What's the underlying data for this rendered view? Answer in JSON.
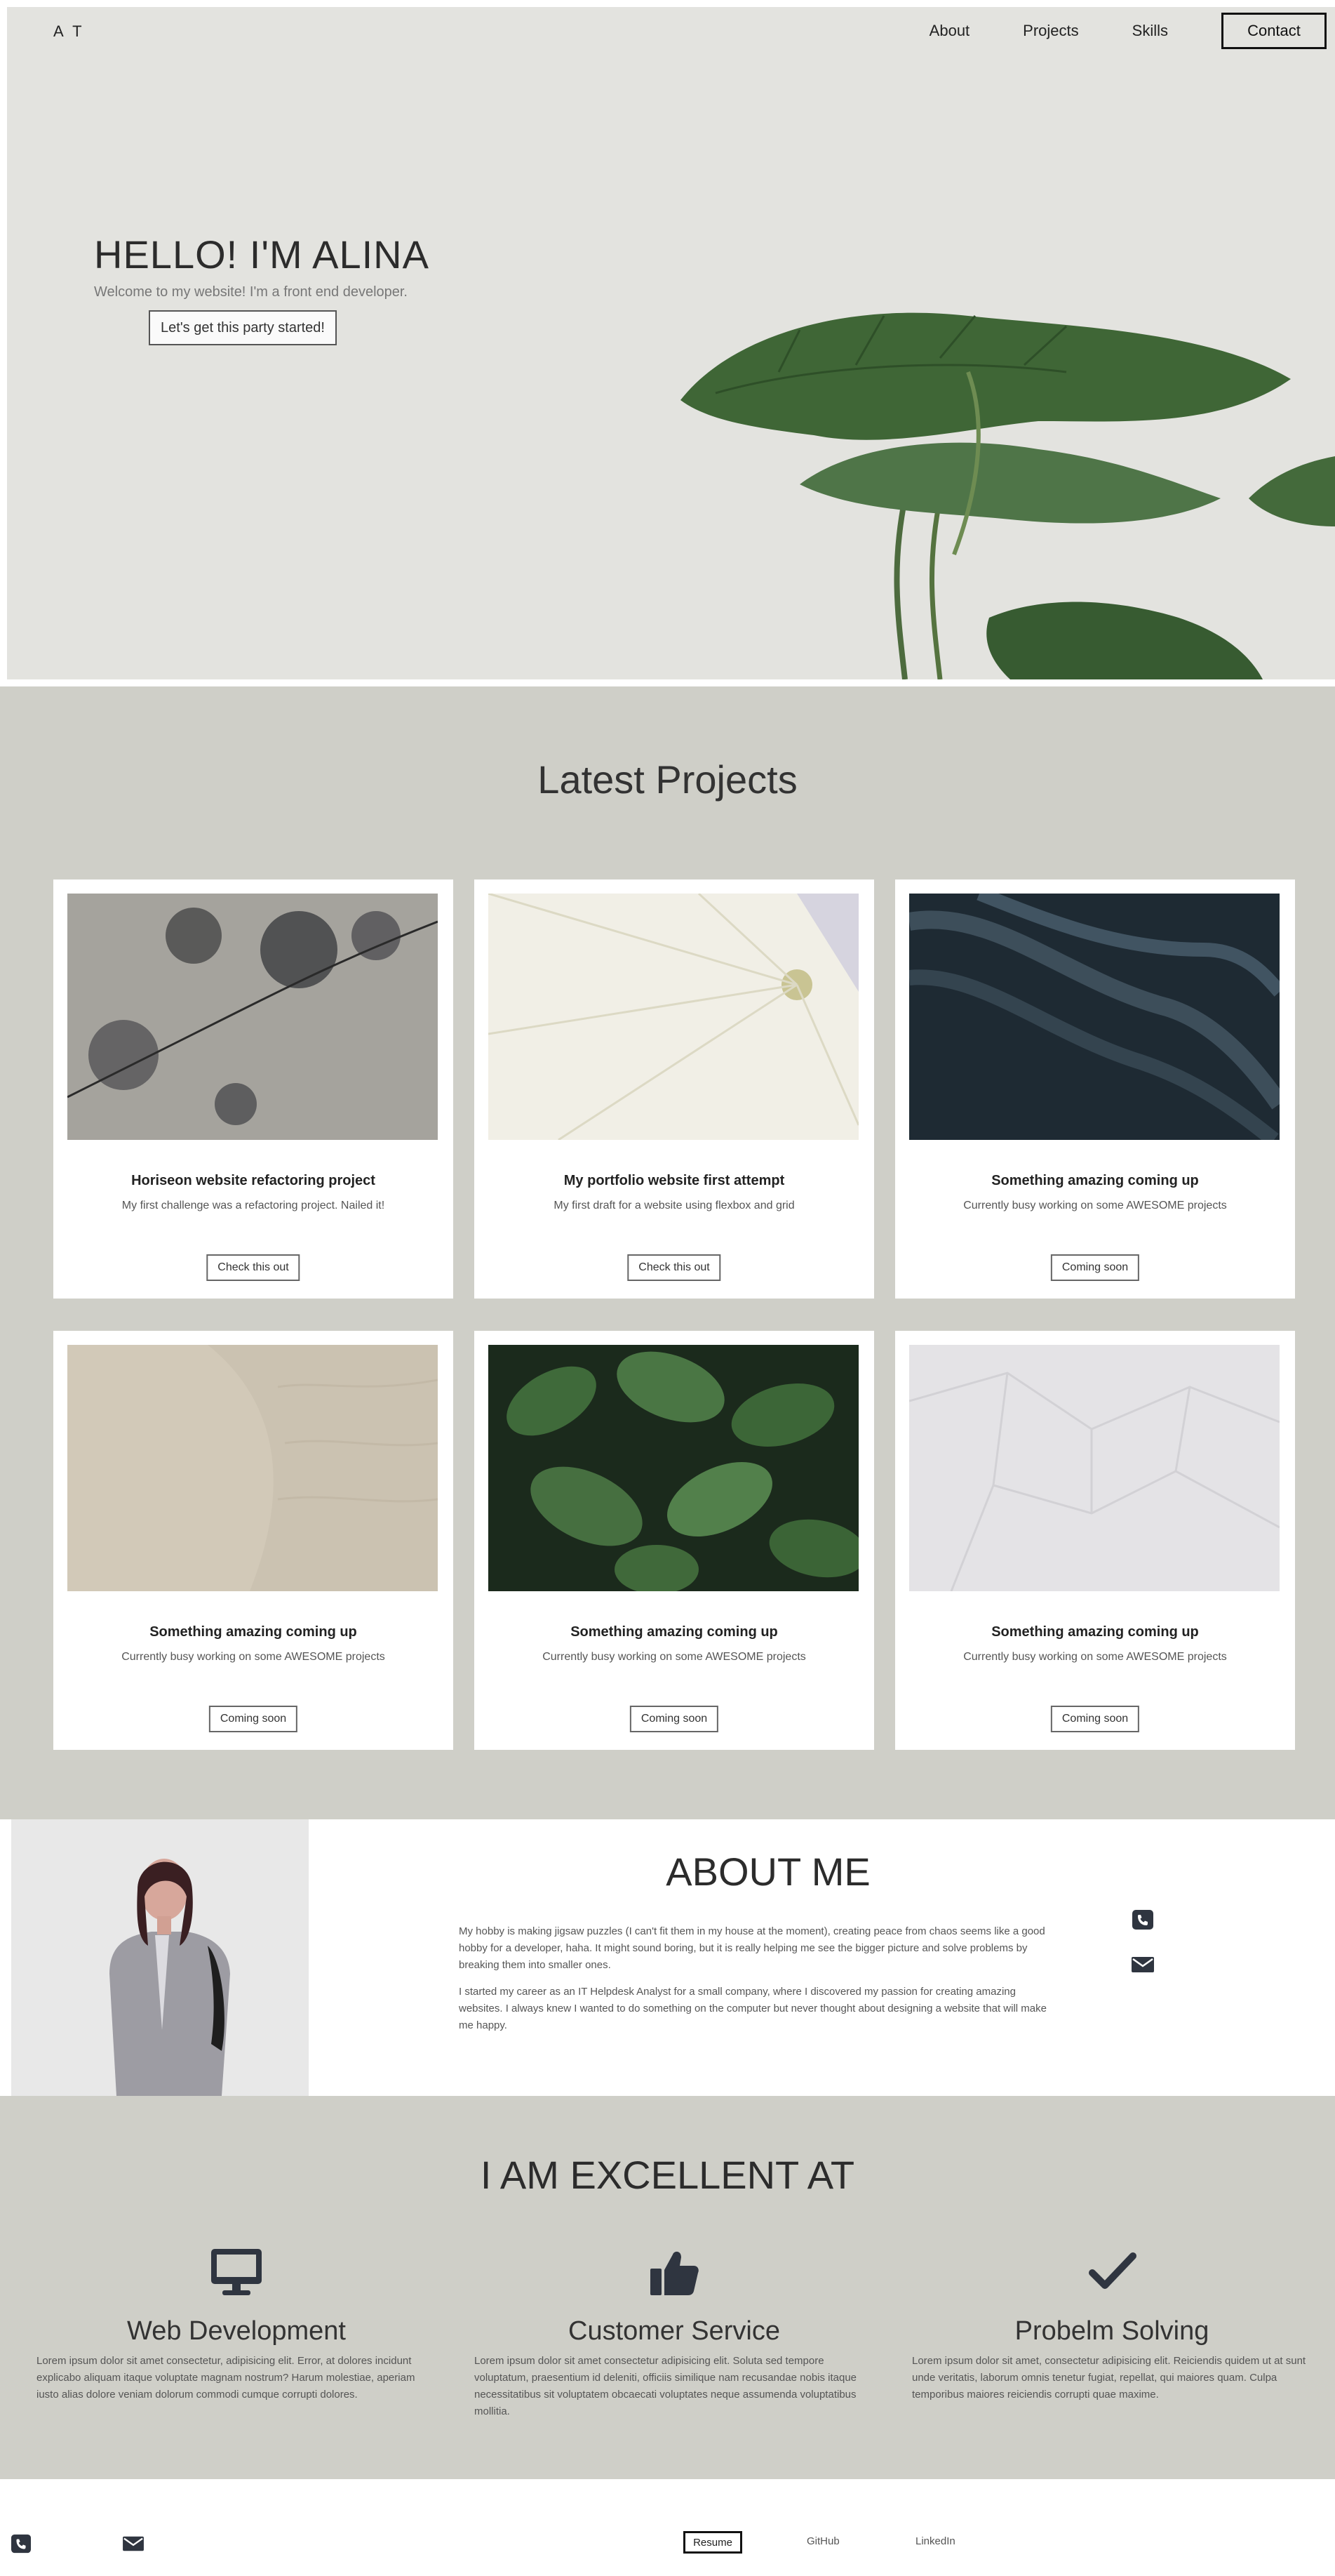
{
  "header": {
    "logo": "A T",
    "nav": [
      "About",
      "Projects",
      "Skills"
    ],
    "contact": "Contact"
  },
  "hero": {
    "title": "HELLO! I'M ALINA",
    "subtitle": "Welcome to my website! I'm a front end developer.",
    "cta": "Let's get this party started!"
  },
  "projects": {
    "title": "Latest Projects",
    "cards": [
      {
        "title": "Horiseon website refactoring project",
        "desc": "My first challenge was a refactoring project. Nailed it!",
        "button": "Check this out",
        "image": "cracked-concrete"
      },
      {
        "title": "My portfolio website first attempt",
        "desc": "My first draft for a website using flexbox and grid",
        "button": "Check this out",
        "image": "white-leaf"
      },
      {
        "title": "Something amazing coming up",
        "desc": "Currently busy working on some AWESOME projects",
        "button": "Coming soon",
        "image": "dark-fabric"
      },
      {
        "title": "Something amazing coming up",
        "desc": "Currently busy working on some AWESOME projects",
        "button": "Coming soon",
        "image": "sand-dunes"
      },
      {
        "title": "Something amazing coming up",
        "desc": "Currently busy working on some AWESOME projects",
        "button": "Coming soon",
        "image": "green-leaves"
      },
      {
        "title": "Something amazing coming up",
        "desc": "Currently busy working on some AWESOME projects",
        "button": "Coming soon",
        "image": "crumpled-paper"
      }
    ]
  },
  "about": {
    "title": "ABOUT ME",
    "p1": "My hobby is making jigsaw puzzles (I can't fit them in my house at the moment), creating peace from chaos seems like a good hobby for a developer, haha. It might sound boring, but it is really helping me see the bigger picture and solve problems by breaking them into smaller ones.",
    "p2": "I started my career as an IT Helpdesk Analyst for a small company, where I discovered my passion for creating amazing websites. I always knew I wanted to do something on the computer but never thought about designing a website that will make me happy."
  },
  "skills": {
    "title": "I AM EXCELLENT AT",
    "items": [
      {
        "name": "Web Development",
        "icon": "desktop-icon",
        "text": "Lorem ipsum dolor sit amet consectetur, adipisicing elit. Error, at dolores incidunt explicabo aliquam itaque voluptate magnam nostrum? Harum molestiae, aperiam iusto alias dolore veniam dolorum commodi cumque corrupti dolores."
      },
      {
        "name": "Customer Service",
        "icon": "thumbs-up-icon",
        "text": "Lorem ipsum dolor sit amet consectetur adipisicing elit. Soluta sed tempore voluptatum, praesentium id deleniti, officiis similique nam recusandae nobis itaque necessitatibus sit voluptatem obcaecati voluptates neque assumenda voluptatibus mollitia."
      },
      {
        "name": "Probelm Solving",
        "icon": "checkmark-icon",
        "text": "Lorem ipsum dolor sit amet, consectetur adipisicing elit. Reiciendis quidem ut at sunt unde veritatis, laborum omnis tenetur fugiat, repellat, qui maiores quam. Culpa temporibus maiores reiciendis corrupti quae maxime."
      }
    ]
  },
  "footer": {
    "resume": "Resume",
    "github": "GitHub",
    "linkedin": "LinkedIn"
  },
  "colors": {
    "hero_bg": "#e3e3df",
    "section_bg": "#cfcfc8",
    "icon": "#2f3540"
  }
}
